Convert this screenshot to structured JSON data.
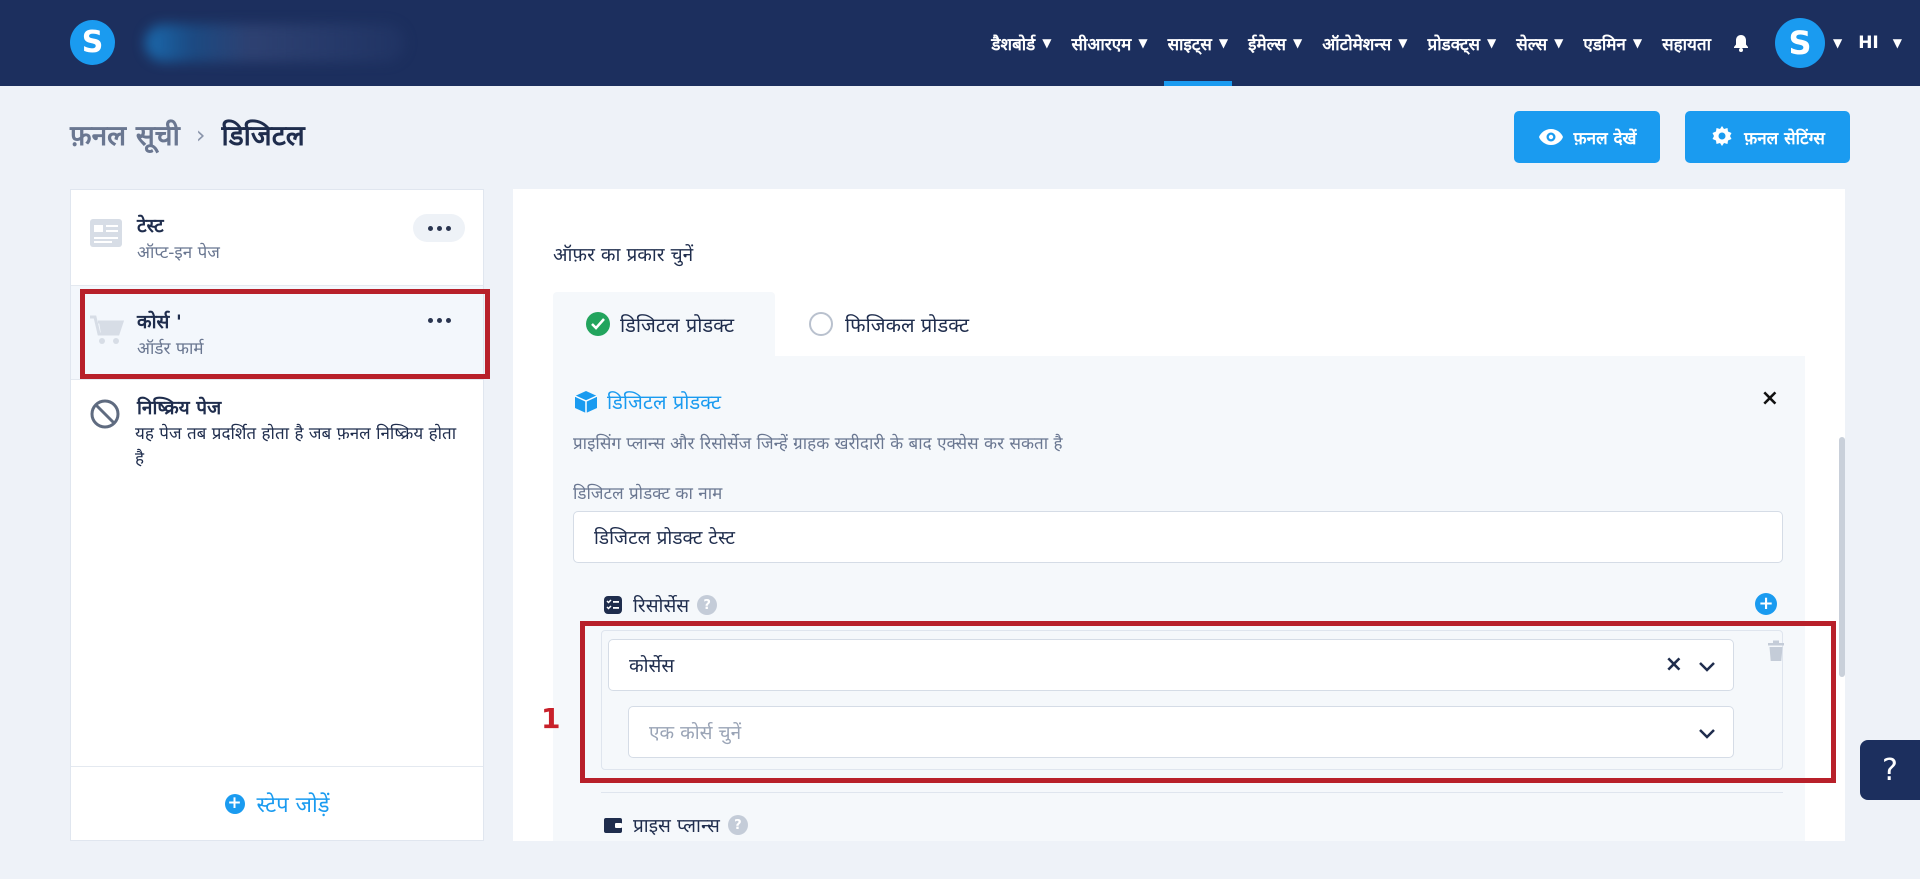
{
  "nav": {
    "logo_letter": "S",
    "items": [
      {
        "label": "डैशबोर्ड"
      },
      {
        "label": "सीआरएम"
      },
      {
        "label": "साइट्स"
      },
      {
        "label": "ईमेल्स"
      },
      {
        "label": "ऑटोमेशन्स"
      },
      {
        "label": "प्रोडक्ट्स"
      },
      {
        "label": "सेल्स"
      },
      {
        "label": "एडमिन"
      }
    ],
    "help_label": "सहायता",
    "avatar_letter": "S",
    "language": "HI",
    "active_item": "साइट्स"
  },
  "header": {
    "breadcrumb_root": "फ़नल सूची",
    "breadcrumb_separator": "›",
    "breadcrumb_current": "डिजिटल",
    "view_funnel_label": "फ़नल देखें",
    "funnel_settings_label": "फ़नल सेटिंग्स"
  },
  "steps": {
    "items": [
      {
        "title": "टेस्ट",
        "subtitle": "ऑप्ट-इन पेज"
      },
      {
        "title": "कोर्स '",
        "subtitle": "ऑर्डर फार्म"
      }
    ],
    "inactive_title": "निष्क्रिय पेज",
    "inactive_desc": "यह पेज तब प्रदर्शित होता है जब फ़नल निष्क्रिय होता है",
    "add_step_label": "स्टेप जोड़ें"
  },
  "offer": {
    "label": "ऑफ़र का प्रकार चुनें",
    "tab_digital": "डिजिटल प्रोडक्ट",
    "tab_physical": "फिजिकल प्रोडक्ट"
  },
  "digital_product": {
    "title": "डिजिटल प्रोडक्ट",
    "close": "×",
    "description": "प्राइसिंग प्लान्स और रिसोर्सेज जिन्हें ग्राहक खरीदारी के बाद एक्सेस कर सकता है",
    "name_label": "डिजिटल प्रोडक्ट का नाम",
    "name_value": "डिजिटल प्रोडक्ट टेस्ट",
    "resources_label": "रिसोर्सेस",
    "resource_type_value": "कोर्सेस",
    "course_placeholder": "एक कोर्स चुनें",
    "price_plans_label": "प्राइस प्लान्स",
    "help_glyph": "?"
  },
  "annotation": {
    "number": "1"
  },
  "help_float": "?",
  "colors": {
    "nav_bg": "#1c2f5e",
    "primary": "#1a9bf0",
    "highlight": "#b8202a",
    "success": "#22a45d"
  }
}
